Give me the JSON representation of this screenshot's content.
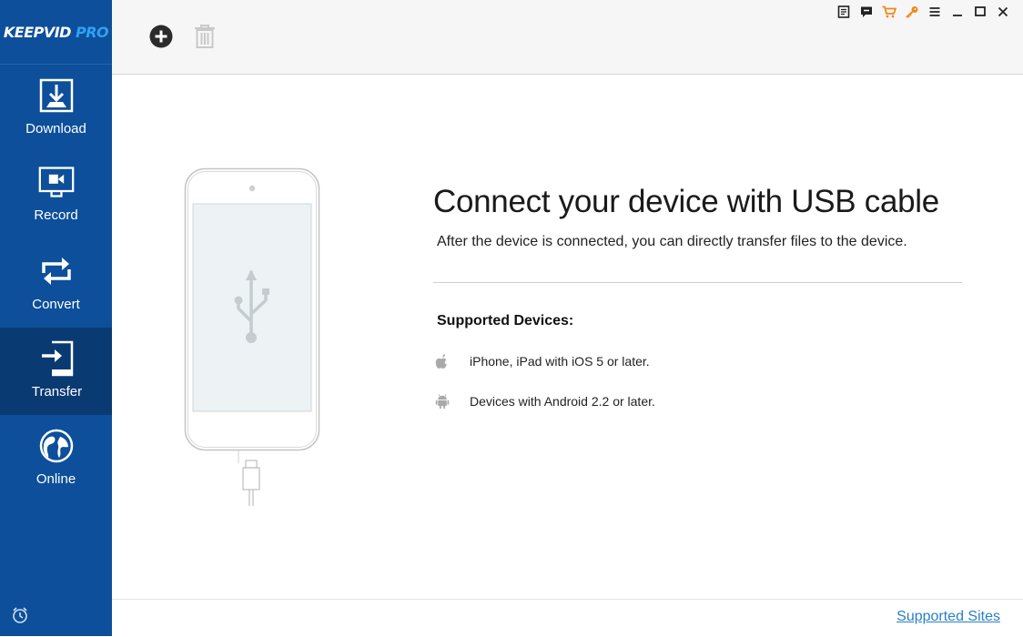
{
  "sidebar": {
    "logo_main": "KEEPVID",
    "logo_pro": "PRO",
    "items": [
      {
        "label": "Download",
        "icon": "download-icon"
      },
      {
        "label": "Record",
        "icon": "record-icon"
      },
      {
        "label": "Convert",
        "icon": "convert-icon"
      },
      {
        "label": "Transfer",
        "icon": "transfer-icon",
        "active": true
      },
      {
        "label": "Online",
        "icon": "online-icon"
      }
    ],
    "bottom_icon": "alarm-clock-icon"
  },
  "toolbar": {
    "add_icon": "add-circle-icon",
    "delete_icon": "trash-icon",
    "window_icons": [
      "notes-icon",
      "feedback-icon",
      "cart-icon",
      "key-icon",
      "menu-icon",
      "minimize-icon",
      "maximize-icon",
      "close-icon"
    ]
  },
  "main": {
    "headline": "Connect your device with USB cable",
    "subtext": "After the device is connected, you can directly transfer files to the device.",
    "supported_title": "Supported Devices:",
    "devices": [
      {
        "text": "iPhone, iPad with iOS 5 or later.",
        "icon": "apple-icon"
      },
      {
        "text": "Devices with Android 2.2 or later.",
        "icon": "android-icon"
      }
    ]
  },
  "footer": {
    "link": "Supported Sites"
  },
  "colors": {
    "sidebar": "#0d4f9a",
    "sidebar_active": "#0a3a72",
    "logo_accent": "#2ea3f2",
    "link": "#2a7fc8",
    "cart_key_orange": "#f08a1c"
  }
}
